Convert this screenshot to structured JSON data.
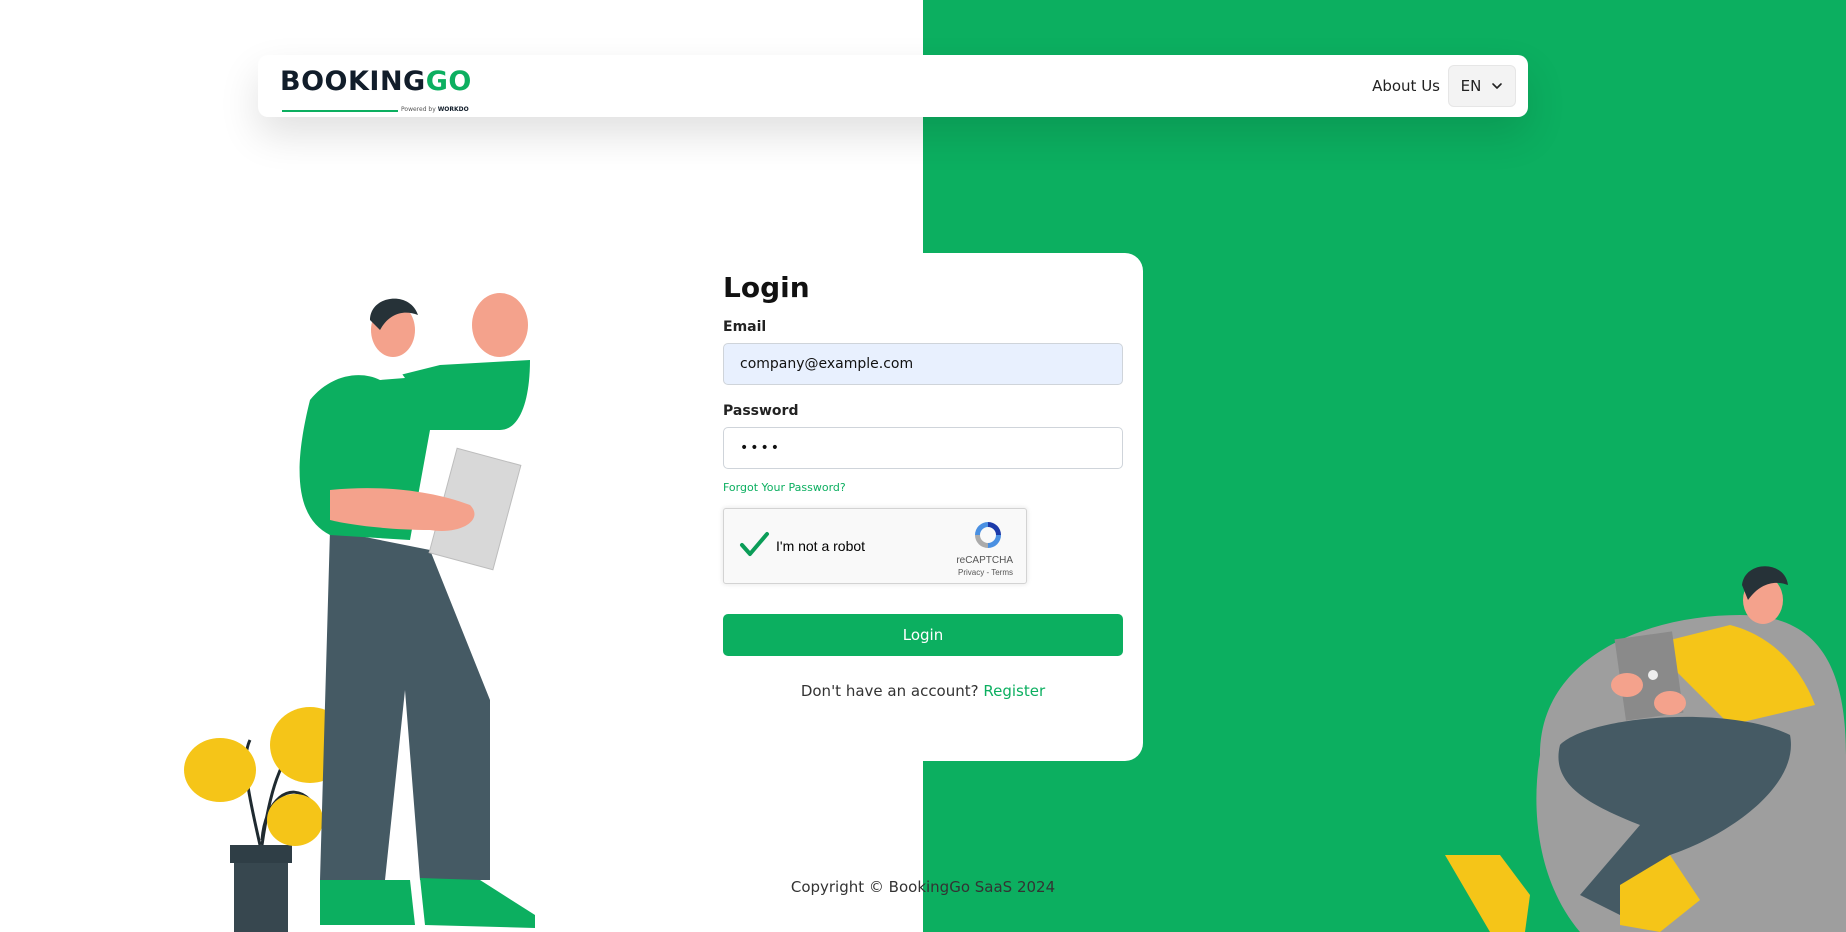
{
  "brand": {
    "logo_primary": "BOOKING",
    "logo_accent": "GO",
    "logo_powered_prefix": "Powered by ",
    "logo_powered_name": "WORKDO",
    "accent_color": "#0caf60",
    "dark_color": "#111d2a"
  },
  "header": {
    "about_label": "About Us",
    "language": "EN",
    "language_icon": "chevron-down-icon"
  },
  "login": {
    "title": "Login",
    "email_label": "Email",
    "email_value": "company@example.com",
    "password_label": "Password",
    "password_value": "••••",
    "forgot_label": "Forgot Your Password?",
    "captcha": {
      "label": "I'm not a robot",
      "brand": "reCAPTCHA",
      "links": "Privacy - Terms",
      "checked": true
    },
    "submit_label": "Login",
    "register_prompt": "Don't have an account?",
    "register_link": "Register"
  },
  "footer": {
    "copyright": "Copyright © BookingGo SaaS 2024"
  }
}
